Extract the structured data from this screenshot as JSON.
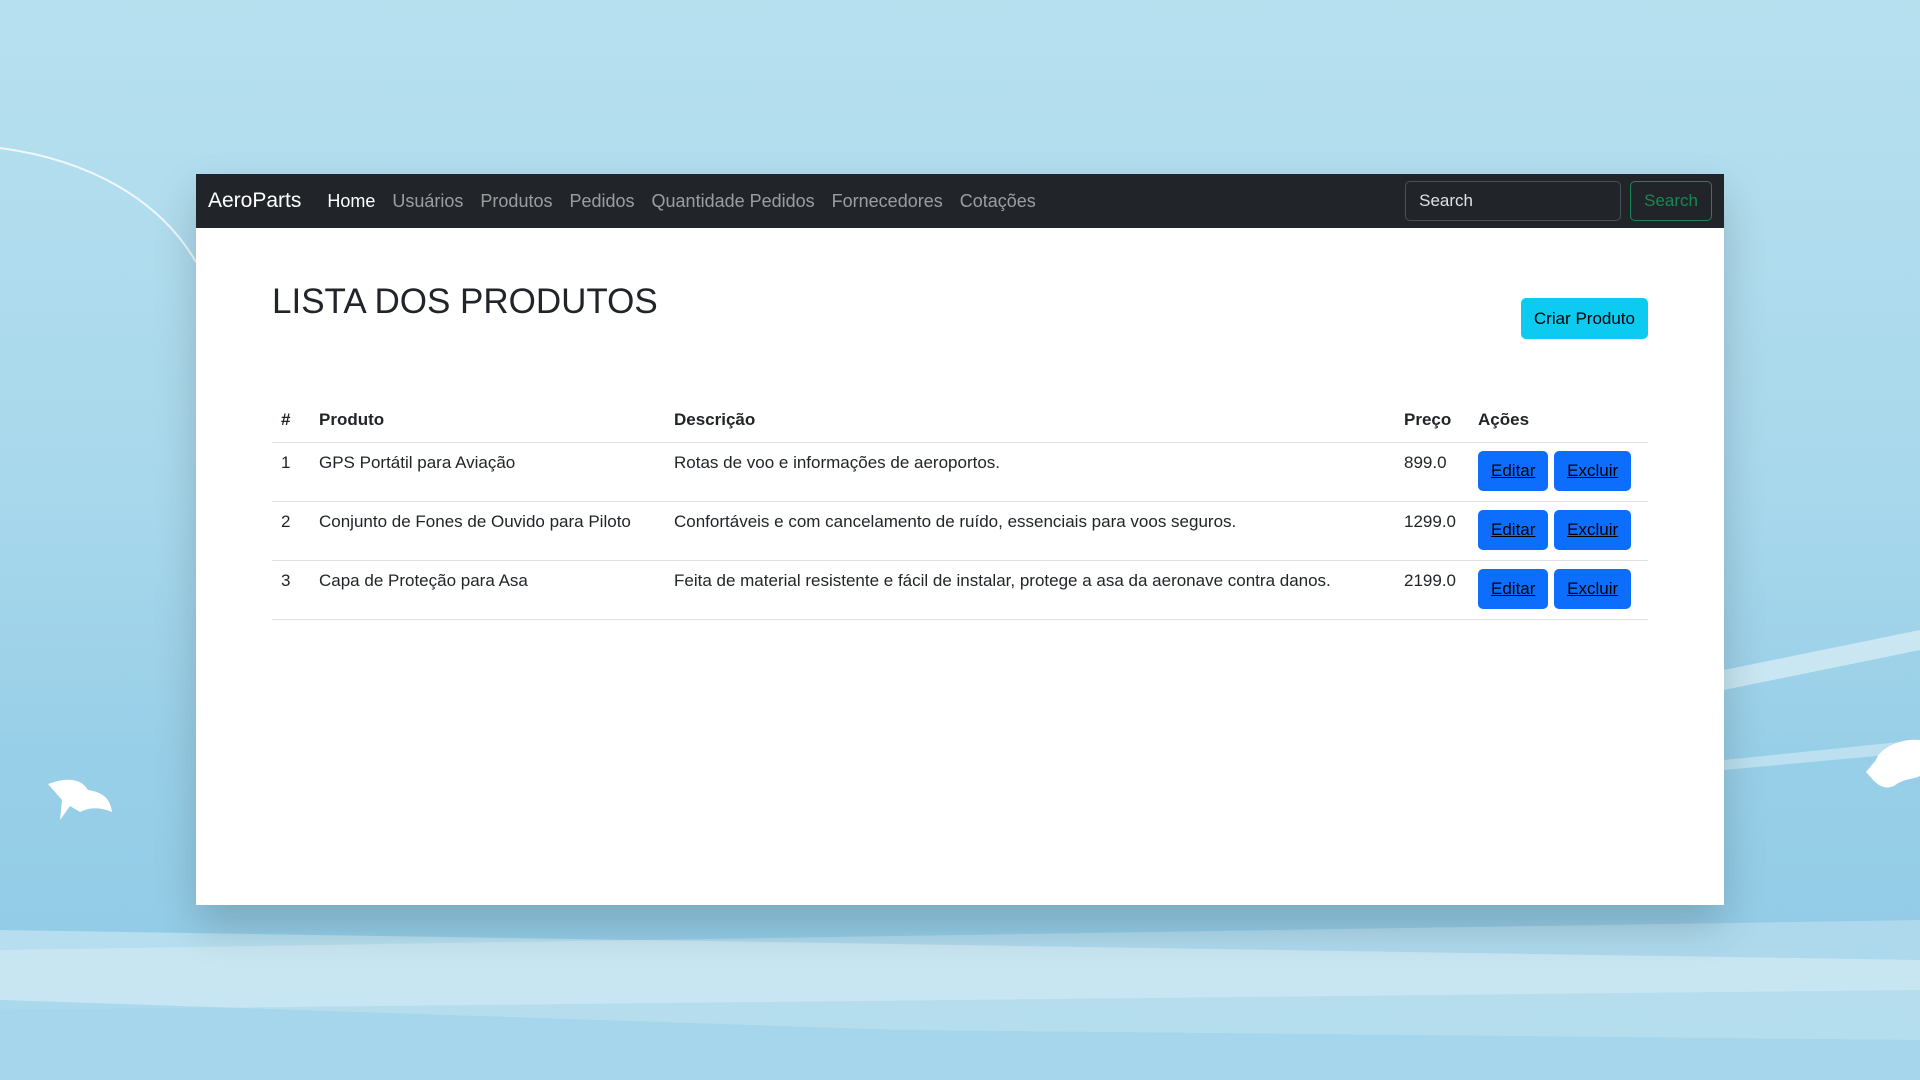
{
  "navbar": {
    "brand": "AeroParts",
    "links": [
      "Home",
      "Usuários",
      "Produtos",
      "Pedidos",
      "Quantidade Pedidos",
      "Fornecedores",
      "Cotações"
    ],
    "search_placeholder": "Search",
    "search_button": "Search"
  },
  "page": {
    "title": "LISTA DOS PRODUTOS",
    "create_button": "Criar Produto"
  },
  "table": {
    "headers": [
      "#",
      "Produto",
      "Descrição",
      "Preço",
      "Ações"
    ],
    "rows": [
      {
        "id": "1",
        "produto": "GPS Portátil para Aviação",
        "descricao": "Rotas de voo e informações de aeroportos.",
        "preco": "899.0",
        "edit": "Editar",
        "delete": "Excluir"
      },
      {
        "id": "2",
        "produto": "Conjunto de Fones de Ouvido para Piloto",
        "descricao": "Confortáveis e com cancelamento de ruído, essenciais para voos seguros.",
        "preco": "1299.0",
        "edit": "Editar",
        "delete": "Excluir"
      },
      {
        "id": "3",
        "produto": "Capa de Proteção para Asa",
        "descricao": "Feita de material resistente e fácil de instalar, protege a asa da aeronave contra danos.",
        "preco": "2199.0",
        "edit": "Editar",
        "delete": "Excluir"
      }
    ]
  },
  "colors": {
    "navbar_bg": "#212529",
    "primary": "#0d6efd",
    "info": "#0dcaf0",
    "success": "#198754",
    "background": "#a8d8ec"
  }
}
